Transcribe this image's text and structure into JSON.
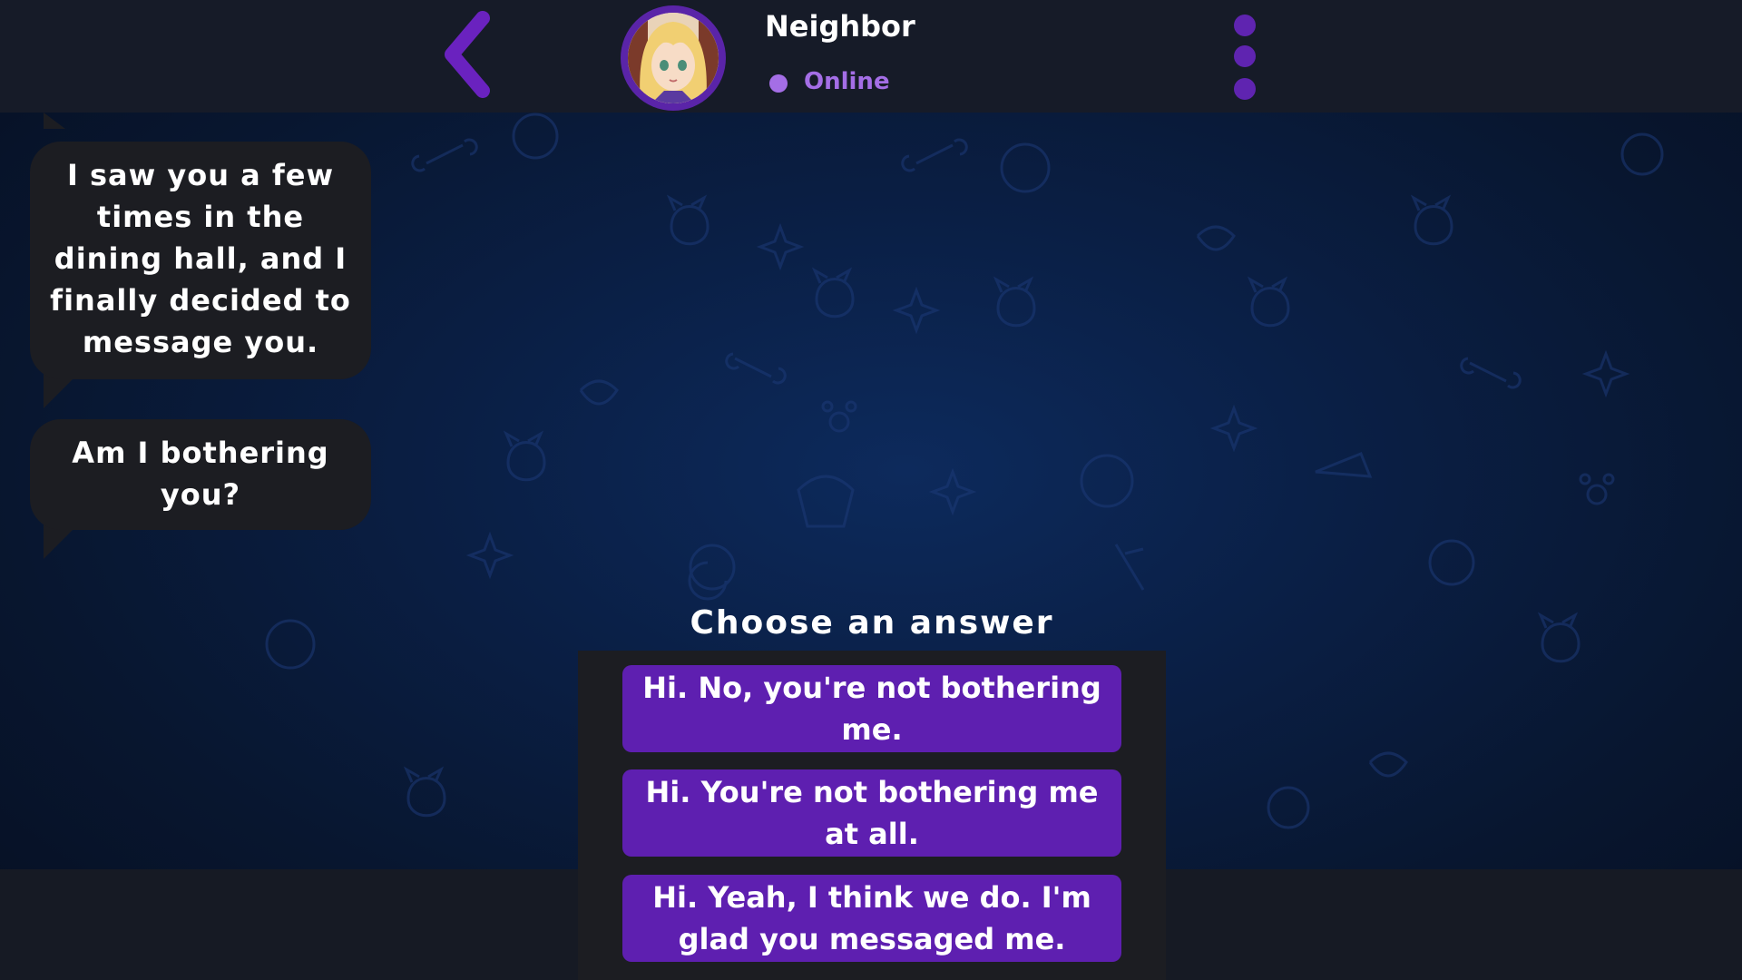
{
  "header": {
    "contact_name": "Neighbor",
    "status": "Online",
    "back_icon": "chevron-left-icon",
    "menu_icon": "vertical-dots-icon"
  },
  "messages": [
    {
      "sender": "Neighbor",
      "text": "I saw you a few times in the dining hall, and I finally decided to message you."
    },
    {
      "sender": "Neighbor",
      "text": "Am I bothering you?"
    }
  ],
  "choices": {
    "title": "Choose an answer",
    "options": [
      "Hi. No, you're not bothering me.",
      "Hi. You're not bothering me at all.",
      "Hi. Yeah, I think we do. I'm glad you messaged me."
    ]
  },
  "colors": {
    "accent": "#5e1fb0",
    "status": "#a46ee6",
    "bubble": "#1c1d22",
    "header": "#161b28"
  }
}
